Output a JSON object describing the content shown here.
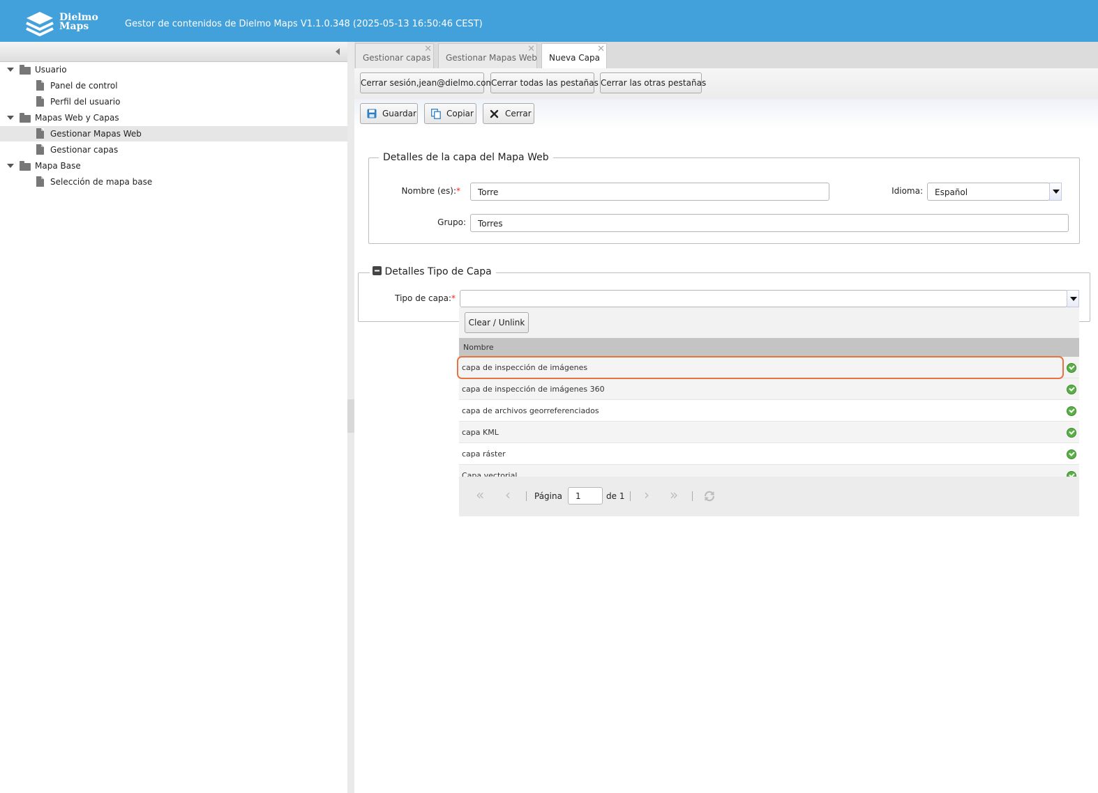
{
  "header": {
    "brand_line1": "Dielmo",
    "brand_line2": "Maps",
    "app_title": "Gestor de contenidos de Dielmo Maps V1.1.0.348 (2025-05-13 16:50:46 CEST)"
  },
  "tree": {
    "items": [
      {
        "label": "Usuario"
      },
      {
        "label": "Panel de control"
      },
      {
        "label": "Perfil del usuario"
      },
      {
        "label": "Mapas Web y Capas"
      },
      {
        "label": "Gestionar Mapas Web"
      },
      {
        "label": "Gestionar capas"
      },
      {
        "label": "Mapa Base"
      },
      {
        "label": "Selección de mapa base"
      }
    ]
  },
  "tabs": [
    {
      "label": "Gestionar capas",
      "close": "✕"
    },
    {
      "label": "Gestionar Mapas Web",
      "close": "✕"
    },
    {
      "label": "Nueva Capa",
      "close": "✕"
    }
  ],
  "session_bar": {
    "logout": "Cerrar sesión,jean@dielmo.com",
    "close_all": "Cerrar todas las pestañas",
    "close_others": "Cerrar las otras pestañas"
  },
  "actions": {
    "save": "Guardar",
    "copy": "Copiar",
    "close": "Cerrar"
  },
  "details": {
    "legend": "Detalles de la capa del Mapa Web",
    "name_label": "Nombre (es):",
    "required_mark": "*",
    "name_value": "Torre",
    "language_label": "Idioma:",
    "language_value": "Español",
    "group_label": "Grupo:",
    "group_value": "Torres"
  },
  "layer_type": {
    "legend": "Detalles Tipo de Capa",
    "type_label": "Tipo de capa:",
    "required_mark": "*",
    "type_value": ""
  },
  "dropdown": {
    "clear_button": "Clear / Unlink",
    "column_header": "Nombre",
    "rows": [
      {
        "name": "capa de inspección de imágenes"
      },
      {
        "name": "capa de inspección de imágenes 360"
      },
      {
        "name": "capa de archivos georreferenciados"
      },
      {
        "name": "capa KML"
      },
      {
        "name": "capa ráster"
      },
      {
        "name": "Capa vectorial"
      }
    ],
    "pager": {
      "page_label": "Página",
      "page_value": "1",
      "of_label": "de 1"
    }
  },
  "colors": {
    "header": "#42a0db",
    "highlight": "#e8733f",
    "check": "#58b047"
  }
}
